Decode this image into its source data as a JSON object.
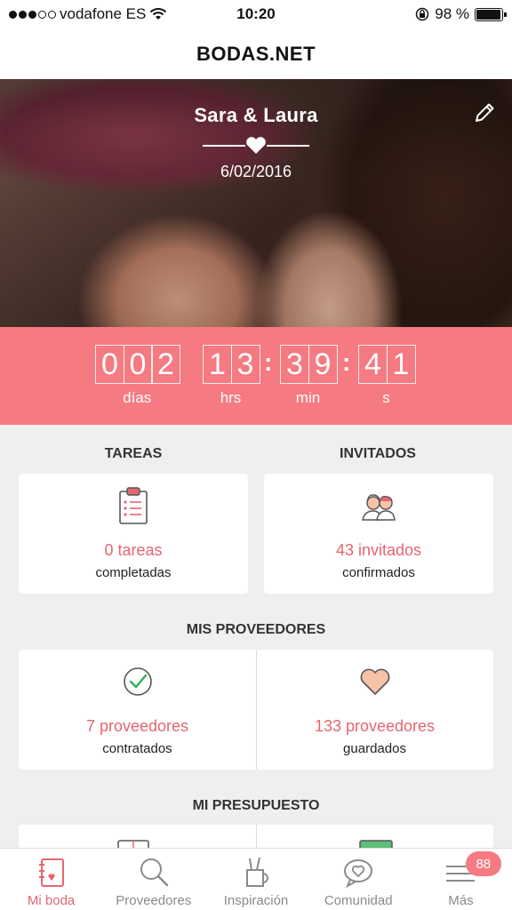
{
  "status_bar": {
    "carrier": "vodafone ES",
    "time": "10:20",
    "battery_text": "98 %",
    "battery_level": 0.98
  },
  "app": {
    "title": "BODAS.NET"
  },
  "hero": {
    "names": "Sara & Laura",
    "date": "6/02/2016"
  },
  "countdown": {
    "days_digits": [
      "0",
      "0",
      "2"
    ],
    "hours_digits": [
      "1",
      "3"
    ],
    "minutes_digits": [
      "3",
      "9"
    ],
    "seconds_digits": [
      "4",
      "1"
    ],
    "days_label": "días",
    "hours_label": "hrs",
    "minutes_label": "min",
    "seconds_label": "s",
    "separator": ":"
  },
  "tasks": {
    "title": "TAREAS",
    "value": "0 tareas",
    "sub": "completadas"
  },
  "guests": {
    "title": "INVITADOS",
    "value": "43 invitados",
    "sub": "confirmados"
  },
  "providers": {
    "title": "MIS PROVEEDORES",
    "hired_value": "7 proveedores",
    "hired_sub": "contratados",
    "saved_value": "133 proveedores",
    "saved_sub": "guardados"
  },
  "budget": {
    "title": "MI PRESUPUESTO"
  },
  "tabs": [
    {
      "label": "Mi boda",
      "icon": "notebook-icon"
    },
    {
      "label": "Proveedores",
      "icon": "search-icon"
    },
    {
      "label": "Inspiración",
      "icon": "brushes-icon"
    },
    {
      "label": "Comunidad",
      "icon": "chat-heart-icon"
    },
    {
      "label": "Más",
      "icon": "menu-icon",
      "badge": "88"
    }
  ],
  "colors": {
    "accent": "#f57a82",
    "accent_text": "#e4666f",
    "background": "#efefef"
  }
}
